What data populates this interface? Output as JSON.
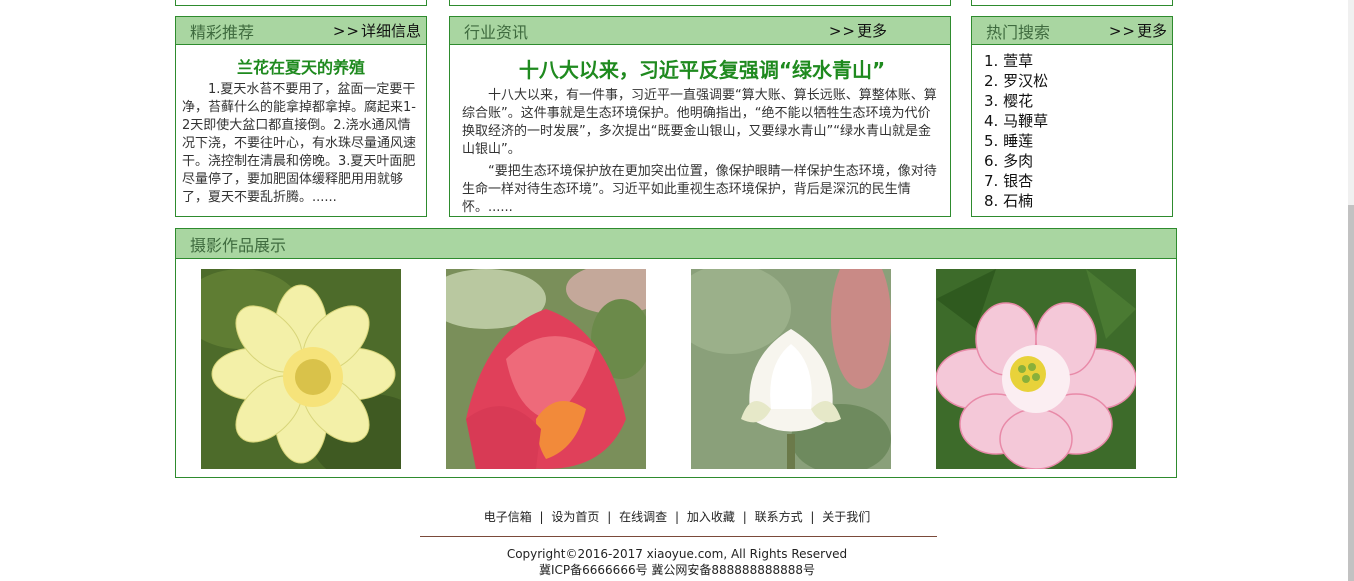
{
  "featured": {
    "title": "精彩推荐",
    "more_arrows": ">>",
    "more_label": "详细信息",
    "article_title": "兰花在夏天的养殖",
    "article_text": "1.夏天水苔不要用了，盆面一定要干净，苔藓什么的能拿掉都拿掉。腐起来1-2天即使大盆口都直接倒。2.浇水通风情况下浇，不要往叶心，有水珠尽量通风速干。浇控制在清晨和傍晚。3.夏天叶面肥尽量停了，要加肥固体缓释肥用用就够了，夏天不要乱折腾。......"
  },
  "news": {
    "title": "行业资讯",
    "more_arrows": ">>",
    "more_label": "更多",
    "article_title": "十八大以来，习近平反复强调“绿水青山”",
    "paragraph_1": "十八大以来，有一件事，习近平一直强调要“算大账、算长远账、算整体账、算综合账”。这件事就是生态环境保护。他明确指出，“绝不能以牺牲生态环境为代价换取经济的一时发展”，多次提出“既要金山银山，又要绿水青山”“绿水青山就是金山银山”。",
    "paragraph_2": "“要把生态环境保护放在更加突出位置，像保护眼睛一样保护生态环境，像对待生命一样对待生态环境”。习近平如此重视生态环境保护，背后是深沉的民生情怀。......"
  },
  "hot": {
    "title": "热门搜索",
    "more_arrows": ">>",
    "more_label": "更多",
    "items": [
      "1. 萱草",
      "2. 罗汉松",
      "3. 樱花",
      "4. 马鞭草",
      "5. 睡莲",
      "6. 多肉",
      "7. 银杏",
      "8. 石楠"
    ]
  },
  "gallery": {
    "title": "摄影作品展示",
    "photos": [
      {
        "name": "yellow-lotus-photo",
        "colors": {
          "bg": "#4d6b2a",
          "petal": "#f3f0a8",
          "center": "#e8c23a"
        }
      },
      {
        "name": "pink-lotus-bud-photo",
        "colors": {
          "bg": "#7a8f5a",
          "petal": "#e0405a",
          "center": "#f28a3a"
        }
      },
      {
        "name": "white-lotus-bud-photo",
        "colors": {
          "bg": "#8aa07a",
          "petal": "#f7f5ee",
          "center": "#d8d6b8"
        }
      },
      {
        "name": "pink-white-lotus-photo",
        "colors": {
          "bg": "#3d6b2a",
          "petal": "#f4c8d8",
          "center": "#e8d23a"
        }
      }
    ]
  },
  "footer": {
    "links": [
      "电子信箱",
      "设为首页",
      "在线调查",
      "加入收藏",
      "联系方式",
      "关于我们"
    ],
    "separator": "|",
    "copyright": "Copyright©2016-2017 xiaoyue.com, All Rights Reserved",
    "icp": "冀ICP备6666666号 冀公网安备888888888888号"
  },
  "colors": {
    "accent_green": "#2e8b2e",
    "header_bg": "#a9d6a1",
    "title_green": "#1f8a1f"
  }
}
